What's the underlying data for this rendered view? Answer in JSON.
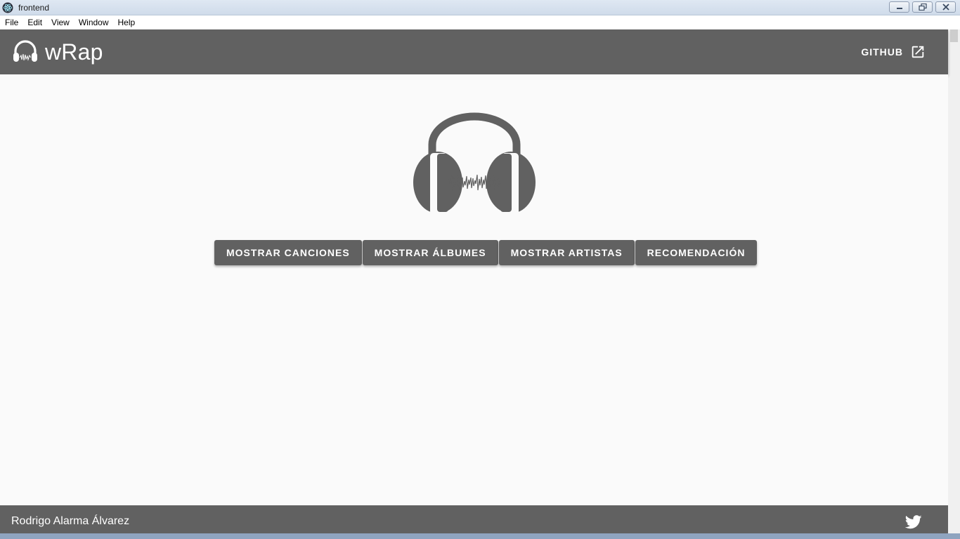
{
  "window": {
    "title": "frontend"
  },
  "menu": {
    "items": [
      "File",
      "Edit",
      "View",
      "Window",
      "Help"
    ]
  },
  "header": {
    "brand": "wRap",
    "github_label": "GITHUB",
    "icons": {
      "brand": "headphones-icon",
      "external": "open-in-new-icon"
    }
  },
  "main": {
    "buttons": [
      "MOSTRAR CANCIONES",
      "MOSTRAR ÁLBUMES",
      "MOSTRAR ARTISTAS",
      "RECOMENDACIÓN"
    ]
  },
  "footer": {
    "author": "Rodrigo Alarma Álvarez",
    "icon": "twitter-icon"
  },
  "colors": {
    "primary": "#616161",
    "background": "#fafafa",
    "on_primary": "#ffffff"
  }
}
